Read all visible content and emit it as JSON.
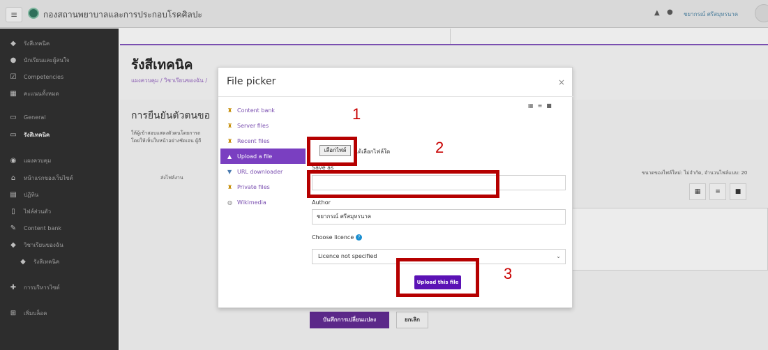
{
  "navbar": {
    "site_name": "กองสถานพยาบาลและการประกอบโรคศิลปะ",
    "user_name": "ชยากรณ์ ศรีสมุทรนาค",
    "icons": [
      "menu-icon",
      "bell-icon",
      "chat-icon"
    ]
  },
  "sidebar": {
    "items": [
      {
        "label": "รังสีเทคนิค",
        "icon": "graduation-cap-icon"
      },
      {
        "label": "นักเรียนและผู้สนใจ",
        "icon": "users-icon"
      },
      {
        "label": "Competencies",
        "icon": "checkbox-icon"
      },
      {
        "label": "คะแนนทั้งหมด",
        "icon": "table-icon"
      },
      {
        "label": "General",
        "icon": "folder-icon"
      },
      {
        "label": "รังสีเทคนิค",
        "icon": "folder-icon"
      },
      {
        "label": "แผงควบคุม",
        "icon": "dashboard-icon"
      },
      {
        "label": "หน้าแรกของเว็บไซต์",
        "icon": "home-icon"
      },
      {
        "label": "ปฏิทิน",
        "icon": "calendar-icon"
      },
      {
        "label": "ไฟล์ส่วนตัว",
        "icon": "file-icon"
      },
      {
        "label": "Content bank",
        "icon": "brush-icon"
      },
      {
        "label": "วิชาเรียนของฉัน",
        "icon": "graduation-cap-icon"
      },
      {
        "label": "รังสีเทคนิค",
        "icon": "graduation-cap-icon"
      },
      {
        "label": "การบริหารไซต์",
        "icon": "wrench-icon"
      },
      {
        "label": "เพิ่มบล็อค",
        "icon": "plus-square-icon"
      }
    ]
  },
  "page": {
    "title": "รังสีเทคนิค",
    "breadcrumb": "แผงควบคุม / วิชาเรียนของฉัน /",
    "section_title": "การยืนยันตัวตนขอ",
    "desc_line1": "ให้ผู้เข้าสอบแสดงตัวตนโดยการถ",
    "desc_line2": "โดยให้เห็นใบหน้าอย่างชัดเจน ผู้ถื",
    "submit_label": "ส่งไฟล์งาน",
    "max_size": "ขนาดของไฟล์ใหม่: ไม่จำกัด, จำนวนไฟล์แนบ: 20",
    "save_button": "บันทึกการเปลี่ยนแปลง",
    "cancel_button": "ยกเลิก"
  },
  "file_picker": {
    "title": "File picker",
    "close": "×",
    "repositories": [
      {
        "label": "Content bank",
        "icon": "repository-icon",
        "active": false
      },
      {
        "label": "Server files",
        "icon": "repository-icon",
        "active": false
      },
      {
        "label": "Recent files",
        "icon": "repository-icon",
        "active": false
      },
      {
        "label": "Upload a file",
        "icon": "upload-icon",
        "active": true
      },
      {
        "label": "URL downloader",
        "icon": "download-icon",
        "active": false
      },
      {
        "label": "Private files",
        "icon": "repository-icon",
        "active": false
      },
      {
        "label": "Wikimedia",
        "icon": "wikimedia-icon",
        "active": false
      }
    ],
    "choose_file_button": "เลือกไฟล์",
    "no_file_text": "ได้เลือกไฟล์ใด",
    "save_as_label": "Save as",
    "save_as_value": "",
    "author_label": "Author",
    "author_value": "ชยากรณ์ ศรีสมุทรนาค",
    "licence_label": "Choose licence",
    "licence_value": "Licence not specified",
    "upload_button": "Upload this file"
  },
  "annotations": {
    "numbers": [
      "1",
      "2",
      "3"
    ],
    "color": "#b50000"
  },
  "colors": {
    "accent": "#7a3fc1",
    "primary_button": "#5b12b5",
    "sidebar_bg": "#2d2d2d"
  }
}
